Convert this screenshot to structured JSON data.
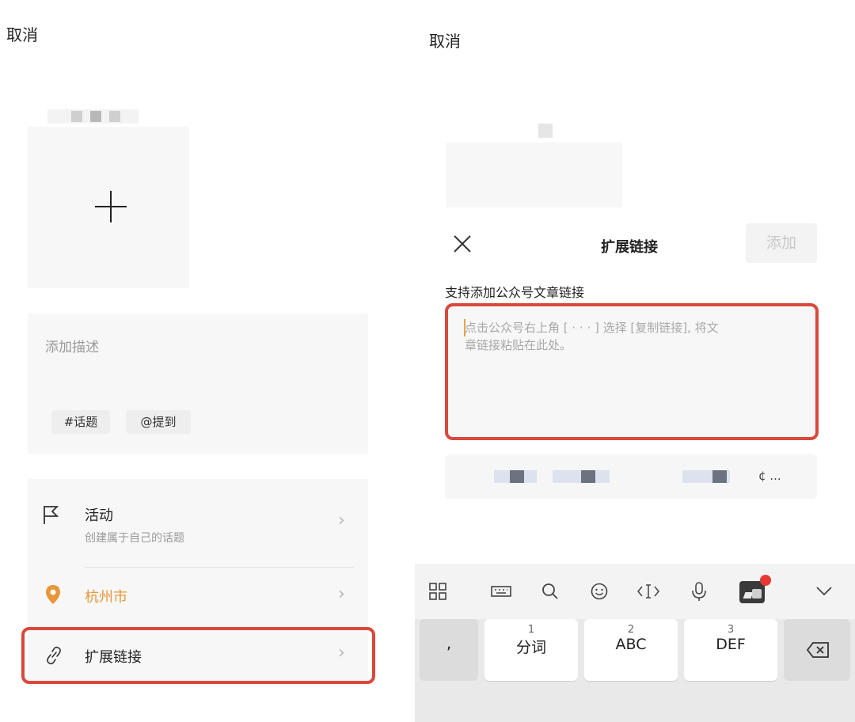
{
  "left": {
    "cancel": "取消",
    "description_placeholder": "添加描述",
    "tags": [
      "#话题",
      "@提到"
    ],
    "activity": {
      "title": "活动",
      "subtitle": "创建属于自己的话题"
    },
    "location": {
      "title": "杭州市",
      "color": "#e8963a"
    },
    "extended_link": {
      "title": "扩展链接"
    }
  },
  "right": {
    "cancel": "取消",
    "modal_title": "扩展链接",
    "add_button": "添加",
    "support_text": "支持添加公众号文章链接",
    "textarea_placeholder_line1": "点击公众号右上角 [ · · · ] 选择 [复制链接], 将文",
    "textarea_placeholder_line2": "章链接粘贴在此处。",
    "suggestion_tail": "¢ ..."
  },
  "keyboard": {
    "toolbar_icons": [
      "grid-icon",
      "keyboard-icon",
      "search-icon",
      "emoji-icon",
      "cursor-icon",
      "mic-icon",
      "image-icon",
      "chevron-down-icon"
    ],
    "keys": [
      {
        "num": "",
        "label": ","
      },
      {
        "num": "1",
        "label": "分词"
      },
      {
        "num": "2",
        "label": "ABC"
      },
      {
        "num": "3",
        "label": "DEF"
      }
    ]
  },
  "colors": {
    "highlight": "#d9483b",
    "accent_orange": "#e8963a",
    "notification_dot": "#e53935"
  }
}
